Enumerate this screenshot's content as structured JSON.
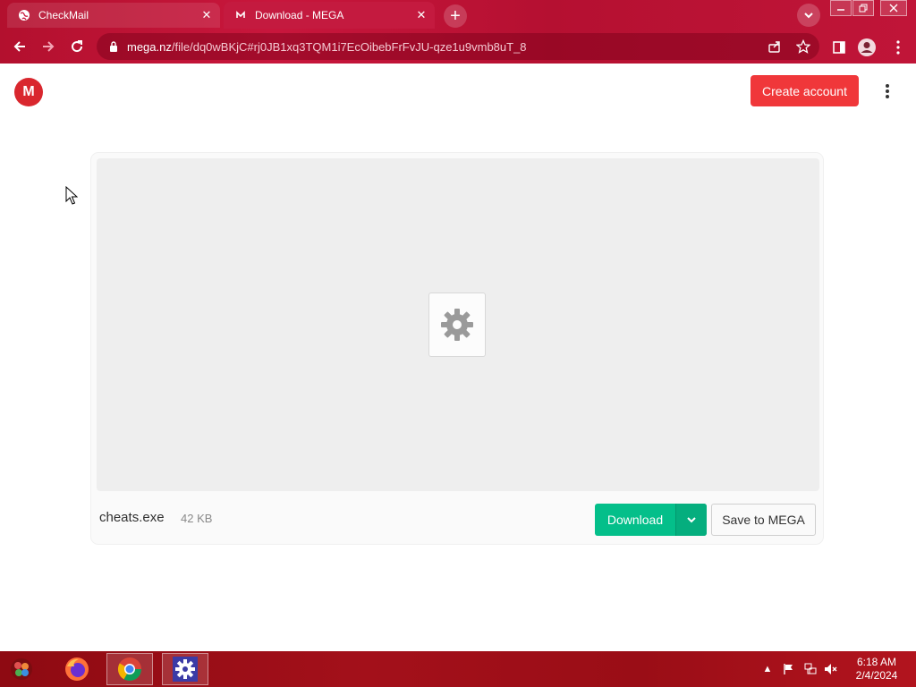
{
  "browser": {
    "tabs": [
      {
        "title": "CheckMail",
        "active": false,
        "icon": "globe-icon"
      },
      {
        "title": "Download - MEGA",
        "active": true,
        "icon": "mega-favicon"
      }
    ],
    "url_host": "mega.nz",
    "url_path": "/file/dq0wBKjC#rj0JB1xq3TQM1i7EcOibebFrFvJU-qze1u9vmb8uT_8",
    "theme_color": "#c8163c"
  },
  "page": {
    "logo_text": "M",
    "create_account_label": "Create account",
    "file": {
      "name": "cheats.exe",
      "size": "42 KB",
      "icon": "gear-icon"
    },
    "download_label": "Download",
    "save_label": "Save to MEGA",
    "colors": {
      "brand": "#d9272e",
      "download": "#04bf8a",
      "create": "#f0373a"
    }
  },
  "taskbar": {
    "apps": [
      "firefox",
      "chrome",
      "settings"
    ],
    "time": "6:18 AM",
    "date": "2/4/2024"
  }
}
